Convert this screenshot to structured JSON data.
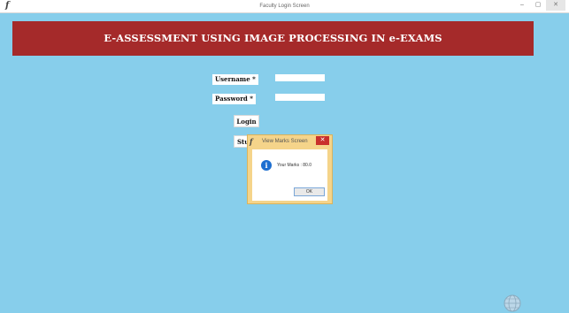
{
  "window": {
    "title": "Faculty Login Screen",
    "controls": {
      "minimize": "–",
      "maximize": "▢",
      "close": "✕"
    }
  },
  "banner": {
    "title": "E-ASSESSMENT USING IMAGE PROCESSING IN e-EXAMS"
  },
  "form": {
    "username_label": "Username *",
    "password_label": "Password *",
    "username_value": "",
    "password_value": "",
    "login_label": "Login",
    "student_button_label": "Stu"
  },
  "dialog": {
    "title": "View Marks Screen",
    "message": "Your Marks : 80.0",
    "ok_label": "OK",
    "close_glyph": "✕"
  },
  "colors": {
    "background": "#87ceeb",
    "banner": "#a52a2a",
    "dialog_frame": "#f5d48a",
    "info": "#1e6fd0"
  }
}
